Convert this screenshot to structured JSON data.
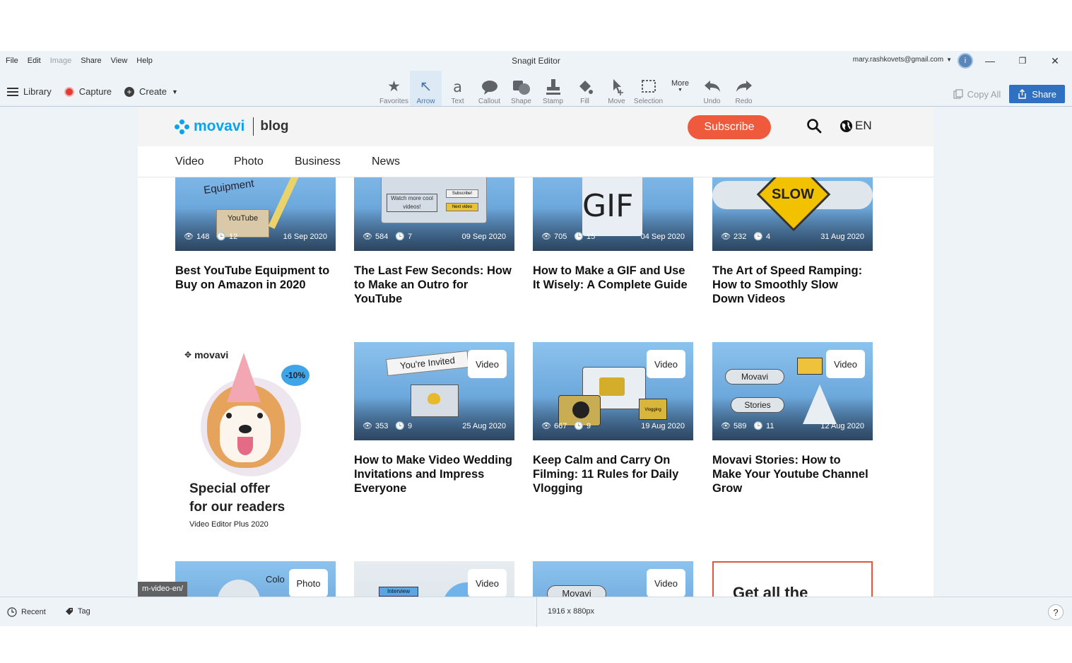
{
  "window": {
    "title": "Snagit Editor",
    "account_email": "mary.rashkovets@gmail.com",
    "avatar_initial": "i",
    "menu": [
      {
        "label": "File",
        "enabled": true
      },
      {
        "label": "Edit",
        "enabled": true
      },
      {
        "label": "Image",
        "enabled": false
      },
      {
        "label": "Share",
        "enabled": true
      },
      {
        "label": "View",
        "enabled": true
      },
      {
        "label": "Help",
        "enabled": true
      }
    ]
  },
  "toolbar": {
    "library_label": "Library",
    "capture_label": "Capture",
    "create_label": "Create",
    "tools": [
      {
        "label": "Favorites",
        "icon": "star-icon",
        "glyph": "★"
      },
      {
        "label": "Arrow",
        "icon": "arrow-icon",
        "glyph": "↖"
      },
      {
        "label": "Text",
        "icon": "text-icon",
        "glyph": "a"
      },
      {
        "label": "Callout",
        "icon": "callout-icon",
        "glyph": "💬"
      },
      {
        "label": "Shape",
        "icon": "shape-icon",
        "glyph": "◼"
      },
      {
        "label": "Stamp",
        "icon": "stamp-icon",
        "glyph": "⬆"
      },
      {
        "label": "Fill",
        "icon": "fill-icon",
        "glyph": "◆"
      },
      {
        "label": "Move",
        "icon": "move-icon",
        "glyph": "↖"
      },
      {
        "label": "Selection",
        "icon": "selection-icon",
        "glyph": "⬚"
      },
      {
        "label": "More",
        "icon": "more-icon",
        "glyph": ""
      },
      {
        "label": "Undo",
        "icon": "undo-icon",
        "glyph": "↶"
      },
      {
        "label": "Redo",
        "icon": "redo-icon",
        "glyph": "↷"
      }
    ],
    "active_tool": "Arrow",
    "copy_all_label": "Copy All",
    "share_label": "Share"
  },
  "site": {
    "logo_text": "movavi",
    "logo_suffix": "blog",
    "subscribe_label": "Subscribe",
    "language": "EN",
    "nav": [
      "Video",
      "Photo",
      "Business",
      "News"
    ],
    "accent_color": "#f05a3c",
    "brand_color": "#0aa4e8"
  },
  "articles_row1": [
    {
      "title": "Best YouTube Equipment to Buy on Amazon in 2020",
      "views": "148",
      "minutes": "12",
      "date": "16 Sep 2020",
      "art": [
        "Equipment",
        "YouTube"
      ]
    },
    {
      "title": "The Last Few Seconds: How to Make an Outro for YouTube",
      "views": "584",
      "minutes": "7",
      "date": "09 Sep 2020",
      "art": [
        "Watch more cool videos!",
        "Subscribe!",
        "Next video"
      ]
    },
    {
      "title": "How to Make a GIF and Use It Wisely: A Complete Guide",
      "views": "705",
      "minutes": "15",
      "date": "04 Sep 2020",
      "art": [
        "GIF"
      ]
    },
    {
      "title": "The Art of Speed Ramping: How to Smoothly Slow Down Videos",
      "views": "232",
      "minutes": "4",
      "date": "31 Aug 2020",
      "art": [
        "SLOW"
      ]
    }
  ],
  "promo": {
    "logo": "movavi",
    "discount": "-10%",
    "headline_1": "Special offer",
    "headline_2": "for our readers",
    "product": "Video Editor Plus 2020"
  },
  "articles_row2": [
    {
      "title": "How to Make Video Wedding Invitations and Impress Everyone",
      "badge": "Video",
      "views": "353",
      "minutes": "9",
      "date": "25 Aug 2020",
      "art": [
        "You're Invited"
      ]
    },
    {
      "title": "Keep Calm and Carry On Filming: 11 Rules for Daily Vlogging",
      "badge": "Video",
      "views": "667",
      "minutes": "9",
      "date": "19 Aug 2020",
      "art": [
        "Vlogging"
      ]
    },
    {
      "title": "Movavi Stories: How to Make Your Youtube Channel Grow",
      "badge": "Video",
      "views": "589",
      "minutes": "11",
      "date": "12 Aug 2020",
      "art": [
        "Movavi",
        "Stories"
      ]
    }
  ],
  "articles_row3": [
    {
      "badge": "Photo",
      "art": "Colo"
    },
    {
      "badge": "Video",
      "art": "Interview"
    },
    {
      "badge": "Video",
      "art": "Movavi"
    }
  ],
  "get_all_text": "Get all the",
  "url_tooltip": "m-video-en/",
  "status": {
    "recent_label": "Recent",
    "tag_label": "Tag",
    "dimensions": "1916 x 880px",
    "help": "?"
  }
}
